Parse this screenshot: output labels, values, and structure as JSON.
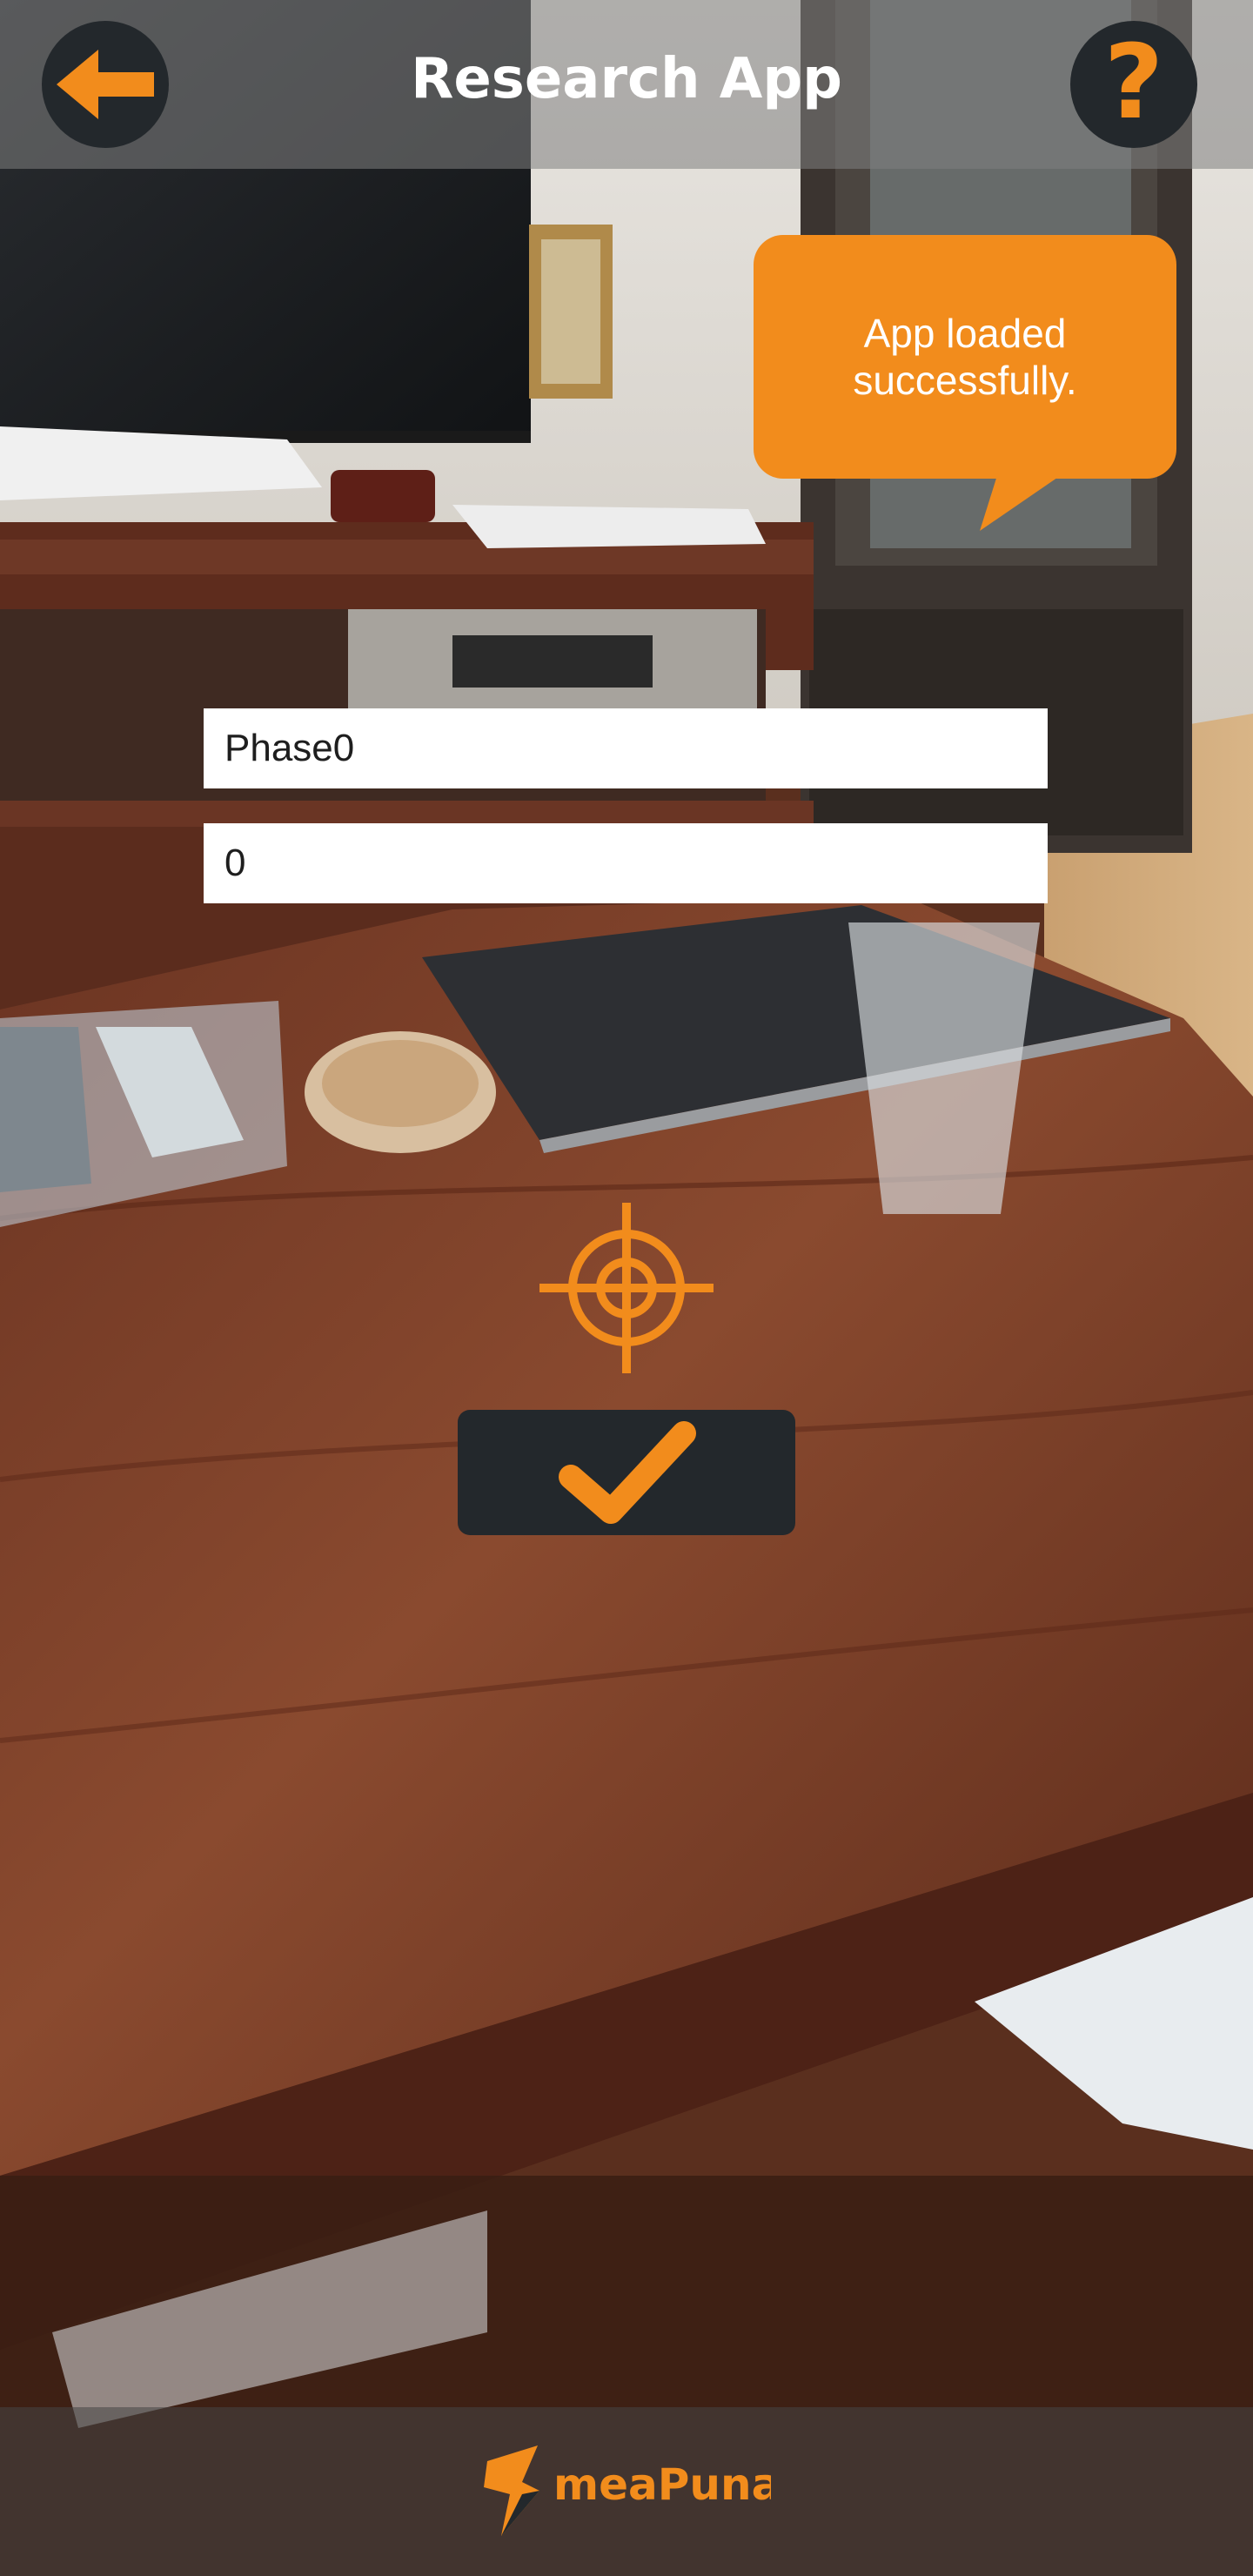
{
  "header": {
    "title": "Research App",
    "back_icon": "arrow-left-icon",
    "help_icon": "question-mark-icon",
    "help_glyph": "?"
  },
  "toast": {
    "message": "App loaded successfully."
  },
  "form": {
    "phase_value": "Phase0",
    "count_value": "0"
  },
  "target": {
    "icon": "crosshair-icon"
  },
  "confirm": {
    "icon": "checkmark-icon"
  },
  "footer": {
    "logo_text": "meaPuna"
  },
  "colors": {
    "accent": "#f28c1c",
    "dark": "#23282c",
    "white": "#ffffff"
  }
}
